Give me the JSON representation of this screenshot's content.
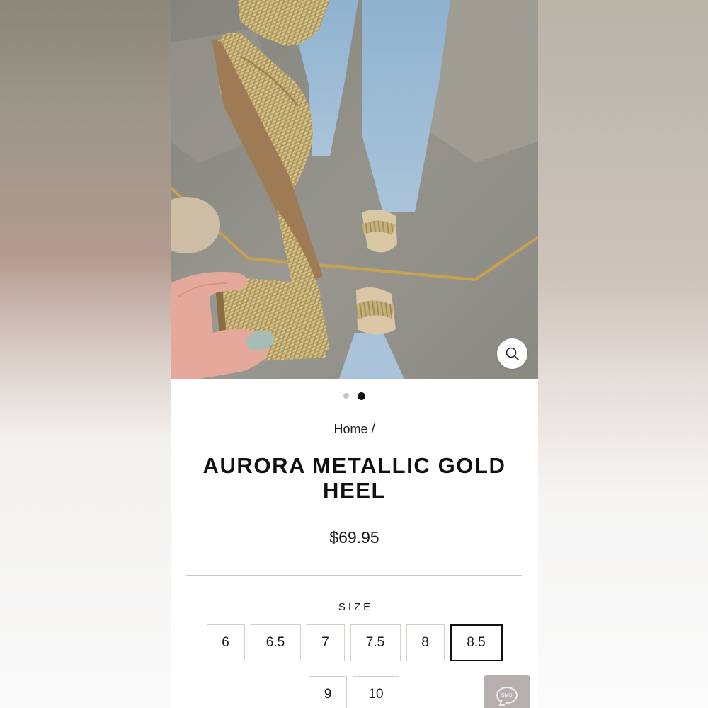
{
  "gallery": {
    "image_alt": "Gold metallic pleated heel held in hand in front of mirror",
    "zoom_icon": "search-icon",
    "dots": [
      false,
      true
    ]
  },
  "breadcrumb": {
    "label": "Home /"
  },
  "product": {
    "title": "AURORA METALLIC GOLD HEEL",
    "price": "$69.95"
  },
  "size": {
    "label": "SIZE",
    "options": [
      "6",
      "6.5",
      "7",
      "7.5",
      "8",
      "8.5",
      "9",
      "10"
    ],
    "selected": "8.5"
  },
  "sms": {
    "label": "SMS",
    "icon": "chat-bubble-icon"
  },
  "colors": {
    "accent": "#111111",
    "divider": "#cfc6bf",
    "sms_background": "#b7aeb0"
  }
}
